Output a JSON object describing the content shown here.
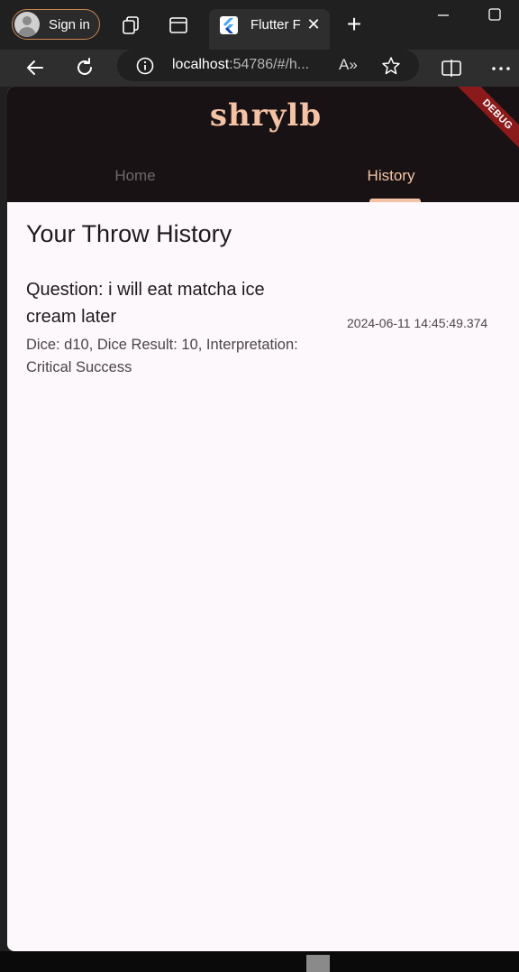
{
  "browser": {
    "signin_label": "Sign in",
    "tab_title": "Flutter F",
    "url_host": "localhost",
    "url_rest": ":54786/#/h...",
    "read_aloud_label": "A»"
  },
  "app": {
    "logo": "shrylb",
    "debug_banner": "DEBUG",
    "tabs": [
      {
        "label": "Home"
      },
      {
        "label": "History"
      }
    ],
    "selected_tab": "History",
    "accent_color": "#f4c3a5"
  },
  "history": {
    "title": "Your Throw History",
    "entries": [
      {
        "question": "Question: i will eat matcha ice cream later",
        "details": "Dice: d10, Dice Result: 10, Interpretation: Critical Success",
        "timestamp": "2024-06-11 14:45:49.374"
      }
    ]
  }
}
